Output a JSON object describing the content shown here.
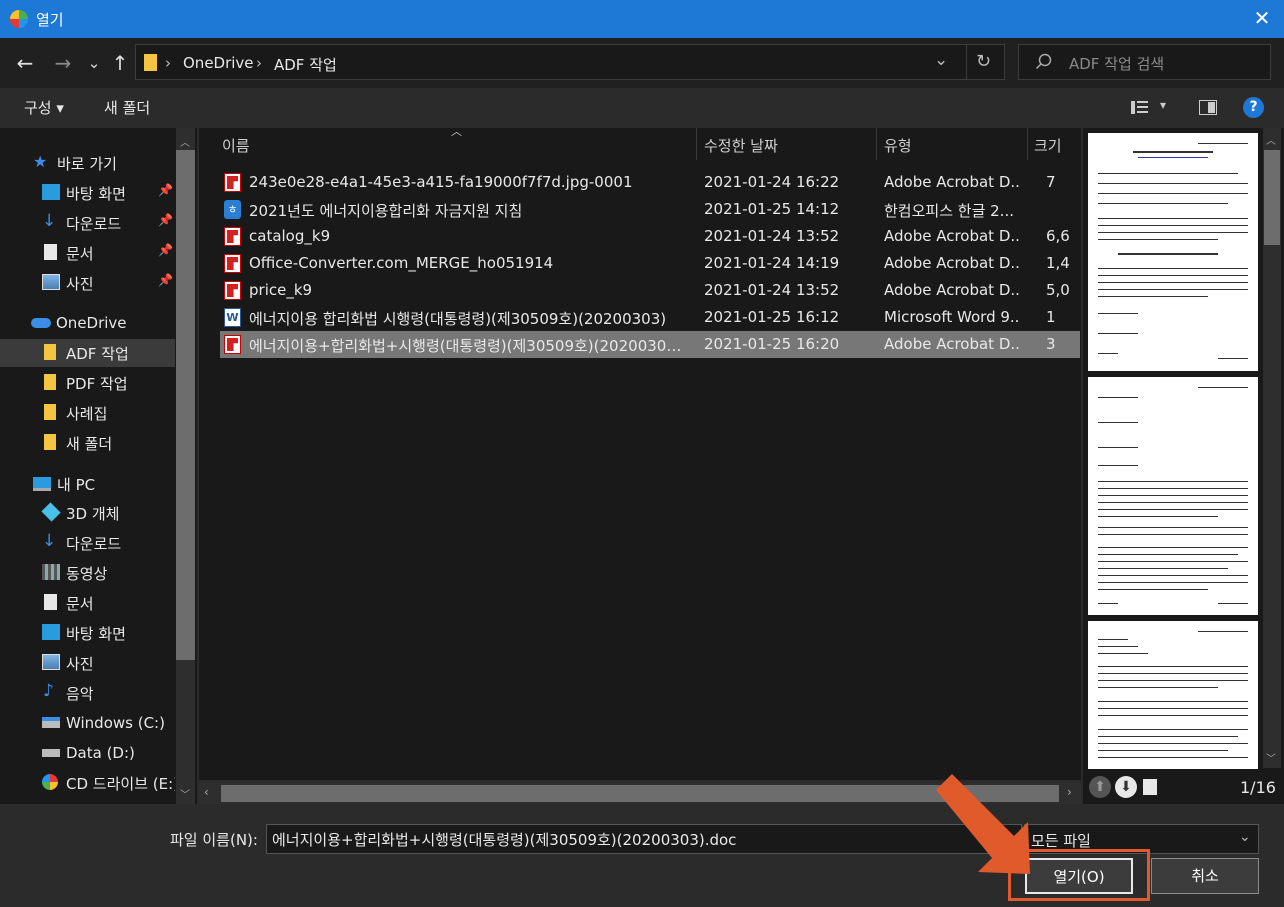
{
  "window": {
    "title": "열기",
    "close_glyph": "✕"
  },
  "nav": {
    "back": "←",
    "forward": "→",
    "recent": "⌄",
    "up": "↑",
    "breadcrumb": [
      "OneDrive",
      "ADF 작업"
    ],
    "separator": "›",
    "dropdown": "⌄",
    "refresh": "↻",
    "search_placeholder": "ADF 작업 검색"
  },
  "toolbar": {
    "organize": "구성 ▾",
    "new_folder": "새 폴더",
    "view_arrow": "▾",
    "help": "?"
  },
  "sidebar": {
    "quick_access": "바로 가기",
    "quick_items": [
      {
        "label": "바탕 화면",
        "icon": "desktop-icon"
      },
      {
        "label": "다운로드",
        "icon": "download-icon"
      },
      {
        "label": "문서",
        "icon": "document-icon"
      },
      {
        "label": "사진",
        "icon": "pictures-icon"
      }
    ],
    "onedrive": "OneDrive",
    "onedrive_items": [
      "ADF 작업",
      "PDF 작업",
      "사례집",
      "새 폴더"
    ],
    "this_pc": "내 PC",
    "pc_items": [
      {
        "label": "3D 개체",
        "icon": "3d-objects-icon"
      },
      {
        "label": "다운로드",
        "icon": "download-icon"
      },
      {
        "label": "동영상",
        "icon": "videos-icon"
      },
      {
        "label": "문서",
        "icon": "document-icon"
      },
      {
        "label": "바탕 화면",
        "icon": "desktop-icon"
      },
      {
        "label": "사진",
        "icon": "pictures-icon"
      },
      {
        "label": "음악",
        "icon": "music-icon"
      },
      {
        "label": "Windows (C:)",
        "icon": "windows-drive-icon"
      },
      {
        "label": "Data (D:)",
        "icon": "drive-icon"
      },
      {
        "label": "CD 드라이브 (E:)",
        "icon": "cd-drive-icon"
      }
    ]
  },
  "columns": {
    "name": "이름",
    "modified": "수정한 날짜",
    "type": "유형",
    "size": "크기"
  },
  "files": [
    {
      "name": "243e0e28-e4a1-45e3-a415-fa19000f7f7d.jpg-0001",
      "date": "2021-01-24 16:22",
      "type": "Adobe Acrobat D...",
      "size": "7",
      "icon": "pdf"
    },
    {
      "name": "2021년도 에너지이용합리화 자금지원 지침",
      "date": "2021-01-25 14:12",
      "type": "한컴오피스 한글 2...",
      "size": "",
      "icon": "hwp"
    },
    {
      "name": "catalog_k9",
      "date": "2021-01-24 13:52",
      "type": "Adobe Acrobat D...",
      "size": "6,6",
      "icon": "pdf"
    },
    {
      "name": "Office-Converter.com_MERGE_ho051914",
      "date": "2021-01-24 14:19",
      "type": "Adobe Acrobat D...",
      "size": "1,4",
      "icon": "pdf"
    },
    {
      "name": "price_k9",
      "date": "2021-01-24 13:52",
      "type": "Adobe Acrobat D...",
      "size": "5,0",
      "icon": "pdf"
    },
    {
      "name": "에너지이용 합리화법 시행령(대통령령)(제30509호)(20200303)",
      "date": "2021-01-25 16:12",
      "type": "Microsoft Word 9...",
      "size": "1",
      "icon": "word"
    },
    {
      "name": "에너지이용+합리화법+시행령(대통령령)(제30509호)(20200303)....",
      "date": "2021-01-25 16:20",
      "type": "Adobe Acrobat D...",
      "size": "3",
      "icon": "pdf",
      "selected": true
    }
  ],
  "preview": {
    "page_indicator": "1/16"
  },
  "bottom": {
    "filename_label": "파일 이름(N):",
    "filename_value": "에너지이용+합리화법+시행령(대통령령)(제30509호)(20200303).doc",
    "filetype": "모든 파일",
    "open": "열기(O)",
    "cancel": "취소"
  },
  "colors": {
    "titlebar": "#1e78d6",
    "highlight": "#e05a2b",
    "selected_row": "#777777"
  }
}
